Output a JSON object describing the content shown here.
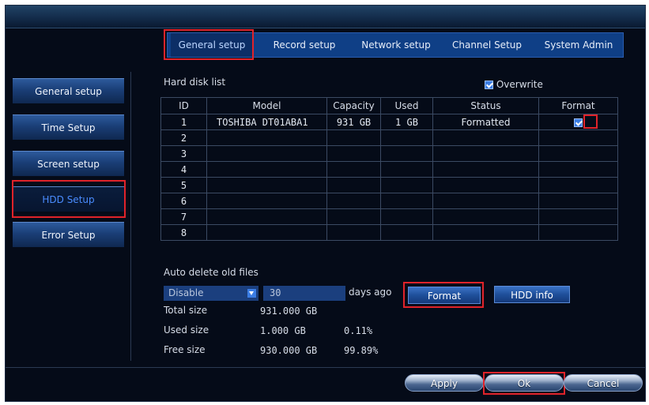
{
  "top_tabs": [
    {
      "label": "General setup",
      "active": true
    },
    {
      "label": "Record setup",
      "active": false
    },
    {
      "label": "Network setup",
      "active": false
    },
    {
      "label": "Channel Setup",
      "active": false
    },
    {
      "label": "System Admin",
      "active": false
    }
  ],
  "sidebar": {
    "items": [
      {
        "label": "General setup",
        "active": false
      },
      {
        "label": "Time Setup",
        "active": false
      },
      {
        "label": "Screen setup",
        "active": false
      },
      {
        "label": "HDD Setup",
        "active": true
      },
      {
        "label": "Error Setup",
        "active": false
      }
    ]
  },
  "hdd": {
    "title": "Hard disk list",
    "overwrite_label": "Overwrite",
    "overwrite_checked": true,
    "columns": [
      "ID",
      "Model",
      "Capacity",
      "Used",
      "Status",
      "Format"
    ],
    "rows": [
      {
        "id": "1",
        "model": "TOSHIBA DT01ABA1",
        "capacity": "931 GB",
        "used": "1 GB",
        "status": "Formatted",
        "format_checked": true
      },
      {
        "id": "2",
        "model": "",
        "capacity": "",
        "used": "",
        "status": "",
        "format_checked": false
      },
      {
        "id": "3",
        "model": "",
        "capacity": "",
        "used": "",
        "status": "",
        "format_checked": false
      },
      {
        "id": "4",
        "model": "",
        "capacity": "",
        "used": "",
        "status": "",
        "format_checked": false
      },
      {
        "id": "5",
        "model": "",
        "capacity": "",
        "used": "",
        "status": "",
        "format_checked": false
      },
      {
        "id": "6",
        "model": "",
        "capacity": "",
        "used": "",
        "status": "",
        "format_checked": false
      },
      {
        "id": "7",
        "model": "",
        "capacity": "",
        "used": "",
        "status": "",
        "format_checked": false
      },
      {
        "id": "8",
        "model": "",
        "capacity": "",
        "used": "",
        "status": "",
        "format_checked": false
      }
    ]
  },
  "auto_delete": {
    "label": "Auto delete old files",
    "select_value": "Disable",
    "days_value": "30",
    "days_suffix": "days ago"
  },
  "buttons": {
    "format": "Format",
    "hdd_info": "HDD info",
    "apply": "Apply",
    "ok": "Ok",
    "cancel": "Cancel"
  },
  "sizes": {
    "total_label": "Total size",
    "total_value": "931.000 GB",
    "used_label": "Used size",
    "used_value": "1.000 GB",
    "used_percent": "0.11%",
    "free_label": "Free size",
    "free_value": "930.000 GB",
    "free_percent": "99.89%"
  },
  "colors": {
    "highlight": "#e1232a",
    "accent": "#3b7de4"
  }
}
